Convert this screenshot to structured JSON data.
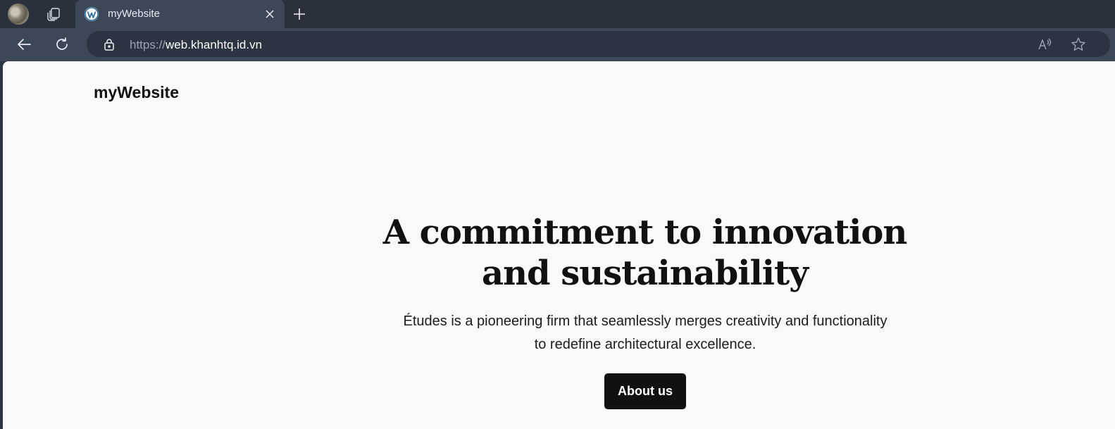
{
  "browser": {
    "tab": {
      "title": "myWebsite",
      "favicon": "wordpress-icon"
    },
    "address_bar": {
      "protocol": "https://",
      "host": "web.khanhtq.id.vn"
    },
    "icons": {
      "profile": "profile-avatar",
      "workspaces": "tab-actions-icon",
      "close": "close-icon",
      "new_tab": "plus-icon",
      "back": "back-arrow-icon",
      "refresh": "refresh-icon",
      "site_info": "lock-icon",
      "read_aloud": "read-aloud-icon",
      "favorite": "star-icon"
    },
    "colors": {
      "tabstrip": "#2a313d",
      "toolbar": "#3c4758",
      "address_bar": "#2c3442"
    }
  },
  "site": {
    "title": "myWebsite",
    "hero": {
      "heading": "A commitment to innovation and sustainability",
      "text": "Études is a pioneering firm that seamlessly merges creativity and functionality to redefine architectural excellence.",
      "button_label": "About us"
    },
    "colors": {
      "background": "#f9f9f9",
      "text": "#111111",
      "button": "#111111",
      "button_text": "#ffffff"
    }
  }
}
